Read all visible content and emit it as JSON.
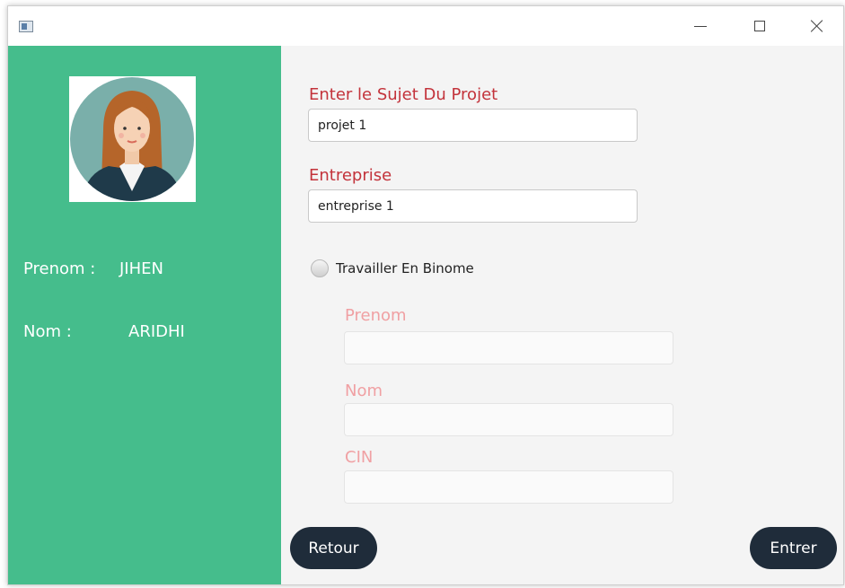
{
  "titlebar": {
    "minimize_icon": "minimize-icon",
    "maximize_icon": "maximize-icon",
    "close_icon": "close-icon"
  },
  "sidebar": {
    "avatar_icon": "user-avatar-illustration",
    "prenom_label": "Prenom :",
    "prenom_value": "JIHEN",
    "nom_label": "Nom :",
    "nom_value": "ARIDHI",
    "background_color": "#45bd8c"
  },
  "form": {
    "sujet_label": "Enter le Sujet Du Projet",
    "sujet_value": "projet 1",
    "entreprise_label": "Entreprise",
    "entreprise_value": "entreprise 1",
    "binome_radio_label": "Travailler En Binome",
    "binome_selected": false,
    "binome": {
      "prenom_label": "Prenom",
      "prenom_value": "",
      "nom_label": "Nom",
      "nom_value": "",
      "cin_label": "CIN",
      "cin_value": ""
    },
    "label_color": "#c3333b"
  },
  "buttons": {
    "retour": "Retour",
    "entrer": "Entrer",
    "color": "#1f2c3a"
  }
}
